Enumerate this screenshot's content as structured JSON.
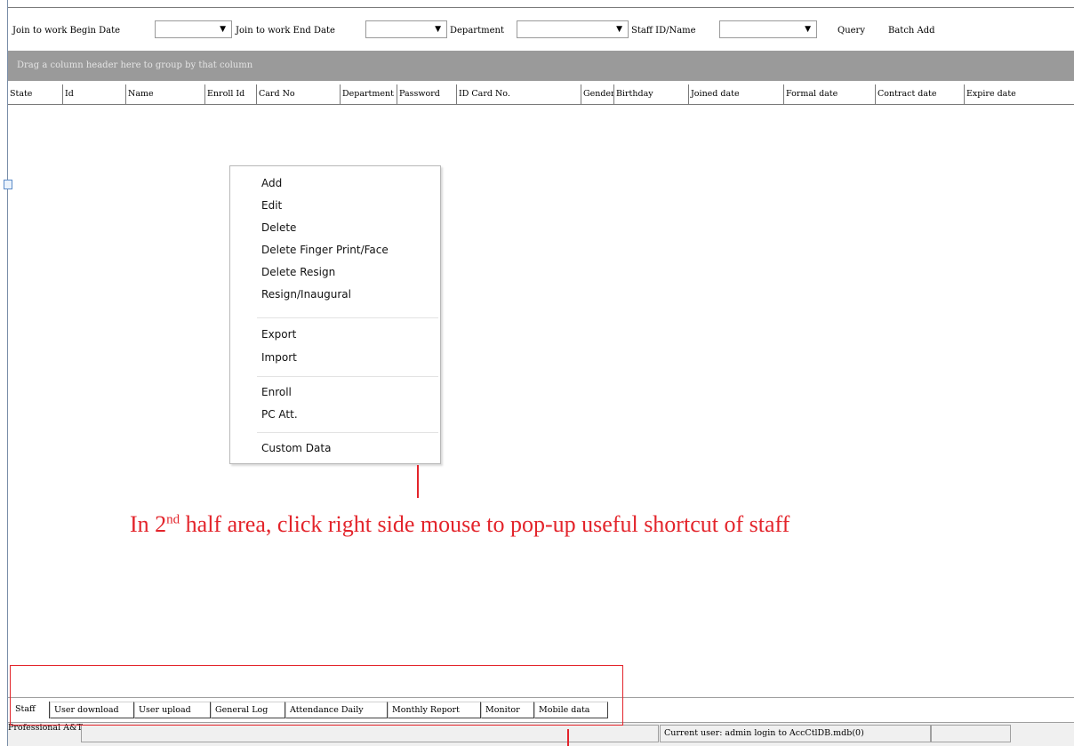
{
  "toolbar": {
    "begin_date_label": "Join to work Begin Date",
    "end_date_label": "Join to work End Date",
    "department_label": "Department",
    "staff_label": "Staff ID/Name",
    "query_label": "Query",
    "batch_add_label": "Batch Add",
    "dropdown_arrow": "▼"
  },
  "groupby": {
    "text": "Drag a column header here to group by that column"
  },
  "grid": {
    "columns": [
      "State",
      "Id",
      "Name",
      "Enroll Id",
      "Card No",
      "Department",
      "Password",
      "ID Card No.",
      "Gender",
      "Birthday",
      "Joined date",
      "Formal date",
      "Contract date",
      "Expire date"
    ]
  },
  "context_menu": {
    "items": [
      "Add",
      "Edit",
      "Delete",
      "Delete Finger Print/Face",
      "Delete Resign",
      "Resign/Inaugural",
      "Export",
      "Import",
      "Enroll",
      "PC Att.",
      "Custom Data"
    ]
  },
  "annotation": {
    "prefix": "In 2",
    "superscript": "nd",
    "suffix": " half area, click right side mouse to pop-up useful shortcut of staff",
    "color": "#e3242b"
  },
  "tabs": [
    "Staff",
    "User download",
    "User upload",
    "General Log",
    "Attendance Daily",
    "Monthly Report",
    "Monitor",
    "Mobile data"
  ],
  "statusbar": {
    "left_text": "Professional A&T",
    "current_user": "Current user: admin  login to AccCtlDB.mdb(0)"
  }
}
